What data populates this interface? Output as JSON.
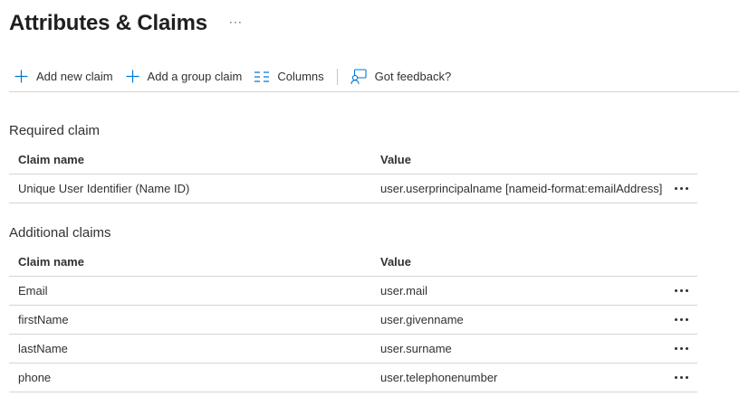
{
  "page": {
    "title": "Attributes & Claims",
    "more_label": "···"
  },
  "toolbar": {
    "add_claim": "Add new claim",
    "add_group_claim": "Add a group claim",
    "columns": "Columns",
    "feedback": "Got feedback?"
  },
  "required": {
    "title": "Required claim",
    "col_name": "Claim name",
    "col_value": "Value",
    "rows": [
      {
        "name": "Unique User Identifier (Name ID)",
        "value": "user.userprincipalname [nameid-format:emailAddress]"
      }
    ]
  },
  "additional": {
    "title": "Additional claims",
    "col_name": "Claim name",
    "col_value": "Value",
    "rows": [
      {
        "name": "Email",
        "value": "user.mail"
      },
      {
        "name": "firstName",
        "value": "user.givenname"
      },
      {
        "name": "lastName",
        "value": "user.surname"
      },
      {
        "name": "phone",
        "value": "user.telephonenumber"
      }
    ]
  },
  "icons": {
    "add": "plus-icon",
    "columns": "columns-icon",
    "feedback": "feedback-icon",
    "row_more": "more-icon"
  },
  "colors": {
    "accent": "#0078d4",
    "text": "#323130",
    "divider": "#d7d5d2"
  }
}
